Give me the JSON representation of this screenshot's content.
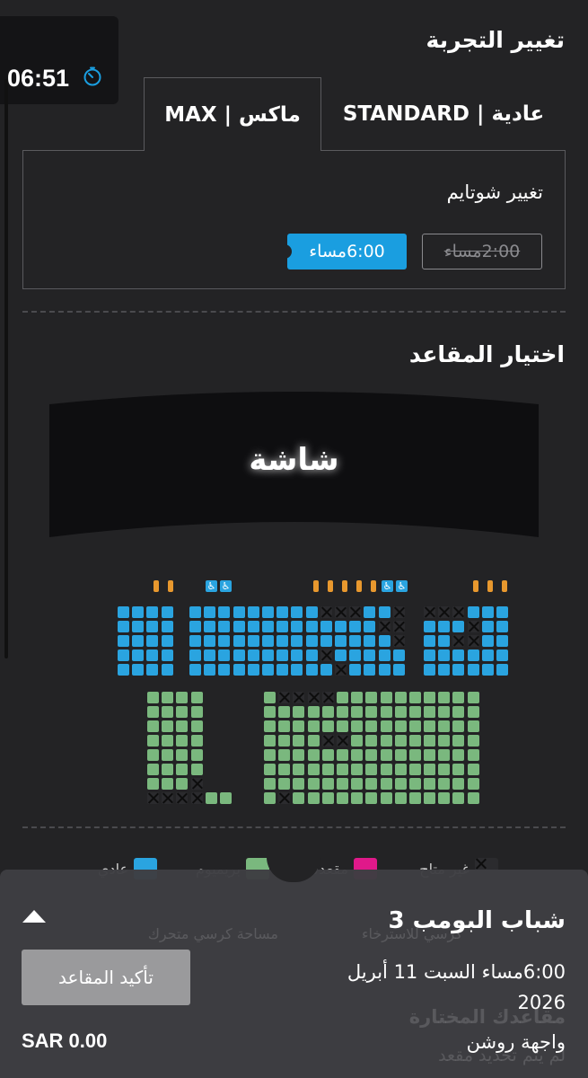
{
  "timer": {
    "time": "06:51"
  },
  "experience": {
    "title": "تغيير التجربة",
    "tabs": [
      {
        "label": "ماكس | MAX",
        "active": true
      },
      {
        "label": "عادية | STANDARD",
        "active": false
      }
    ]
  },
  "showtime": {
    "title": "تغيير شوتايم",
    "options": [
      {
        "label": "6:00مساء",
        "state": "selected"
      },
      {
        "label": "2:00مساء",
        "state": "unavailable"
      }
    ]
  },
  "seats": {
    "title": "اختيار المقاعد",
    "screen_label": "شاشة"
  },
  "legend": {
    "unavailable": "غير متاح",
    "selected": "مقعدك",
    "premium": "بريميوم",
    "standard": "عادي",
    "recliner": "كرسي للاسترخاء",
    "wheelchair": "مساحة كرسي متحرك"
  },
  "colors": {
    "standard": "#2aa4e0",
    "premium": "#7ab87e",
    "selected": "#e0198a",
    "recliner": "#e8982e",
    "accent": "#1a9ee0"
  },
  "selected_seats": {
    "title": "مقاعدك المختارة",
    "empty_text": "لم يتم تحديد مقعد"
  },
  "booking": {
    "movie": "شباب البومب 3",
    "when": "6:00مساء السبت 11 أبريل 2026",
    "venue": "واجهة روشن",
    "confirm_label": "تأكيد المقاعد",
    "total": "SAR 0.00"
  }
}
